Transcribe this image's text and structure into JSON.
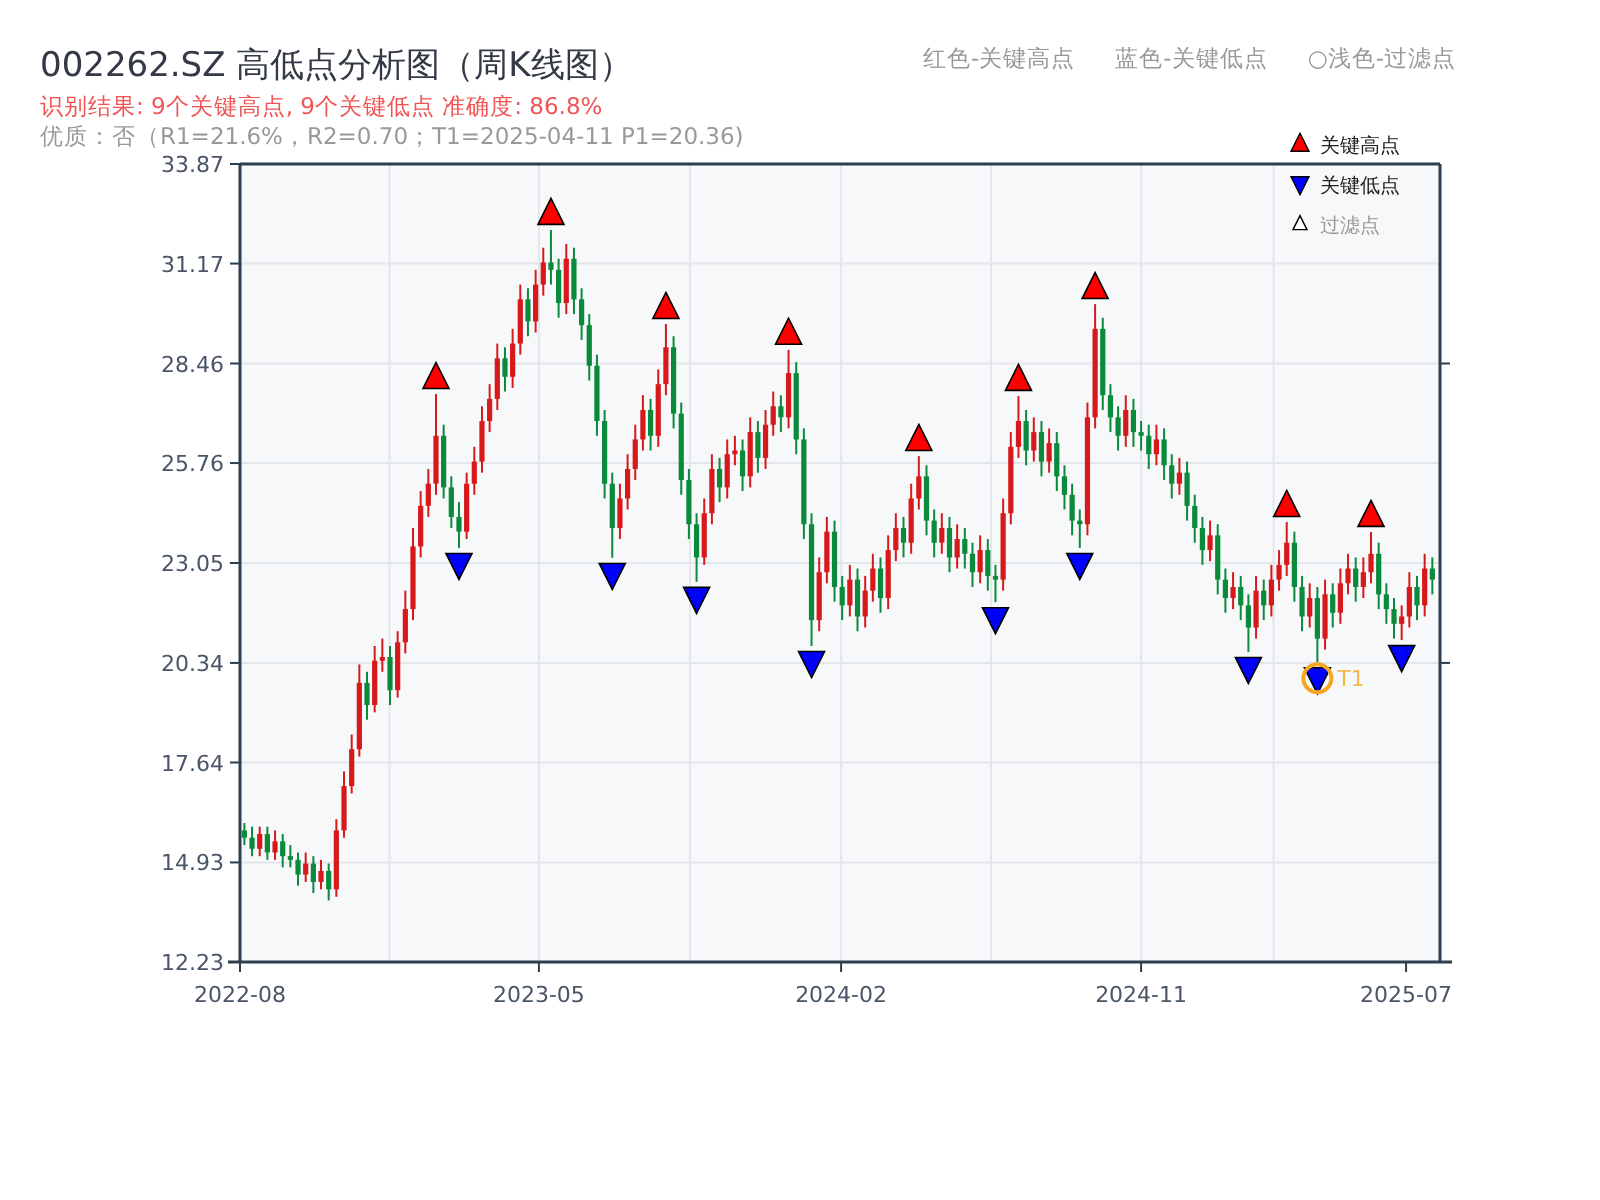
{
  "title": "002262.SZ 高低点分析图（周K线图）",
  "header_legend": [
    "红色-关键高点",
    "蓝色-关键低点",
    "○浅色-过滤点"
  ],
  "result_line": "识别结果: 9个关键高点, 9个关键低点  准确度: 86.8%",
  "quality_line": "优质：否（R1=21.6%，R2=0.70；T1=2025-04-11 P1=20.36)",
  "chart": {
    "filtered_legend": {
      "label": "过滤点"
    },
    "chart_data": {
      "type": "candlestick",
      "grid": true,
      "xlim": [
        "2022-08-01",
        "2025-08-01"
      ],
      "ylim": [
        12.23,
        33.87
      ],
      "xticks": [
        {
          "value": "2022-08-01",
          "label": "2022-08"
        },
        {
          "value": "2023-05-01",
          "label": "2023-05"
        },
        {
          "value": "2024-02-01",
          "label": "2024-02"
        },
        {
          "value": "2024-11-01",
          "label": "2024-11"
        },
        {
          "value": "2025-07-01",
          "label": "2025-07"
        }
      ],
      "yticks": [
        12.23,
        14.93,
        17.64,
        20.34,
        23.05,
        25.76,
        28.46,
        31.17,
        33.87
      ],
      "annotations": [
        {
          "x": "2025-04-11",
          "y": 20.36,
          "text": "T1"
        }
      ],
      "x": [
        "2022-08-05",
        "2022-08-12",
        "2022-08-19",
        "2022-08-26",
        "2022-09-02",
        "2022-09-09",
        "2022-09-16",
        "2022-09-23",
        "2022-09-30",
        "2022-10-07",
        "2022-10-14",
        "2022-10-21",
        "2022-10-28",
        "2022-11-04",
        "2022-11-11",
        "2022-11-18",
        "2022-11-25",
        "2022-12-02",
        "2022-12-09",
        "2022-12-16",
        "2022-12-23",
        "2022-12-30",
        "2023-01-06",
        "2023-01-13",
        "2023-01-20",
        "2023-01-27",
        "2023-02-03",
        "2023-02-10",
        "2023-02-17",
        "2023-02-24",
        "2023-03-03",
        "2023-03-10",
        "2023-03-17",
        "2023-03-24",
        "2023-03-31",
        "2023-04-07",
        "2023-04-14",
        "2023-04-21",
        "2023-04-28",
        "2023-05-05",
        "2023-05-12",
        "2023-05-19",
        "2023-05-26",
        "2023-06-02",
        "2023-06-09",
        "2023-06-16",
        "2023-06-23",
        "2023-06-30",
        "2023-07-07",
        "2023-07-14",
        "2023-07-21",
        "2023-07-28",
        "2023-08-04",
        "2023-08-11",
        "2023-08-18",
        "2023-08-25",
        "2023-09-01",
        "2023-09-08",
        "2023-09-15",
        "2023-09-22",
        "2023-09-29",
        "2023-10-06",
        "2023-10-13",
        "2023-10-20",
        "2023-10-27",
        "2023-11-03",
        "2023-11-10",
        "2023-11-17",
        "2023-11-24",
        "2023-12-01",
        "2023-12-08",
        "2023-12-15",
        "2023-12-22",
        "2023-12-29",
        "2024-01-05",
        "2024-01-12",
        "2024-01-19",
        "2024-01-26",
        "2024-02-02",
        "2024-02-09",
        "2024-02-16",
        "2024-02-23",
        "2024-03-01",
        "2024-03-08",
        "2024-03-15",
        "2024-03-22",
        "2024-03-29",
        "2024-04-05",
        "2024-04-12",
        "2024-04-19",
        "2024-04-26",
        "2024-05-03",
        "2024-05-10",
        "2024-05-17",
        "2024-05-24",
        "2024-05-31",
        "2024-06-07",
        "2024-06-14",
        "2024-06-21",
        "2024-06-28",
        "2024-07-05",
        "2024-07-12",
        "2024-07-19",
        "2024-07-26",
        "2024-08-02",
        "2024-08-09",
        "2024-08-16",
        "2024-08-23",
        "2024-08-30",
        "2024-09-06",
        "2024-09-13",
        "2024-09-20",
        "2024-09-27",
        "2024-10-04",
        "2024-10-11",
        "2024-10-18",
        "2024-10-25",
        "2024-11-01",
        "2024-11-08",
        "2024-11-15",
        "2024-11-22",
        "2024-11-29",
        "2024-12-06",
        "2024-12-13",
        "2024-12-20",
        "2024-12-27",
        "2025-01-03",
        "2025-01-10",
        "2025-01-17",
        "2025-01-24",
        "2025-01-31",
        "2025-02-07",
        "2025-02-14",
        "2025-02-21",
        "2025-02-28",
        "2025-03-07",
        "2025-03-14",
        "2025-03-21",
        "2025-03-28",
        "2025-04-04",
        "2025-04-11",
        "2025-04-18",
        "2025-04-25",
        "2025-05-02",
        "2025-05-09",
        "2025-05-16",
        "2025-05-23",
        "2025-05-30",
        "2025-06-06",
        "2025-06-13",
        "2025-06-20",
        "2025-06-27",
        "2025-07-04",
        "2025-07-11",
        "2025-07-18",
        "2025-07-25"
      ],
      "ohlc": [
        [
          15.8,
          16.0,
          15.4,
          15.6
        ],
        [
          15.6,
          15.9,
          15.1,
          15.3
        ],
        [
          15.3,
          15.9,
          15.1,
          15.7
        ],
        [
          15.7,
          15.9,
          15.0,
          15.2
        ],
        [
          15.2,
          15.8,
          15.0,
          15.5
        ],
        [
          15.5,
          15.7,
          14.8,
          15.1
        ],
        [
          15.1,
          15.4,
          14.8,
          15.0
        ],
        [
          15.0,
          15.2,
          14.3,
          14.6
        ],
        [
          14.6,
          15.2,
          14.4,
          14.9
        ],
        [
          14.9,
          15.1,
          14.1,
          14.4
        ],
        [
          14.4,
          15.0,
          14.2,
          14.7
        ],
        [
          14.7,
          14.9,
          13.9,
          14.2
        ],
        [
          14.2,
          16.1,
          14.0,
          15.8
        ],
        [
          15.8,
          17.4,
          15.6,
          17.0
        ],
        [
          17.0,
          18.4,
          16.8,
          18.0
        ],
        [
          18.0,
          20.3,
          17.8,
          19.8
        ],
        [
          19.8,
          20.1,
          18.8,
          19.2
        ],
        [
          19.2,
          20.8,
          19.0,
          20.4
        ],
        [
          20.4,
          21.0,
          20.1,
          20.5
        ],
        [
          20.5,
          20.8,
          19.2,
          19.6
        ],
        [
          19.6,
          21.2,
          19.4,
          20.9
        ],
        [
          20.9,
          22.3,
          20.6,
          21.8
        ],
        [
          21.8,
          24.0,
          21.5,
          23.5
        ],
        [
          23.5,
          25.0,
          23.2,
          24.6
        ],
        [
          24.6,
          25.6,
          24.3,
          25.2
        ],
        [
          25.2,
          27.63,
          24.9,
          26.5
        ],
        [
          26.5,
          26.8,
          24.8,
          25.1
        ],
        [
          25.1,
          25.4,
          24.0,
          24.3
        ],
        [
          24.3,
          24.7,
          23.46,
          23.9
        ],
        [
          23.9,
          25.5,
          23.7,
          25.2
        ],
        [
          25.2,
          26.2,
          24.9,
          25.8
        ],
        [
          25.8,
          27.3,
          25.5,
          26.9
        ],
        [
          26.9,
          27.9,
          26.6,
          27.5
        ],
        [
          27.5,
          29.0,
          27.2,
          28.6
        ],
        [
          28.6,
          28.9,
          27.7,
          28.1
        ],
        [
          28.1,
          29.4,
          27.8,
          29.0
        ],
        [
          29.0,
          30.6,
          28.7,
          30.2
        ],
        [
          30.2,
          30.5,
          29.2,
          29.6
        ],
        [
          29.6,
          31.0,
          29.3,
          30.6
        ],
        [
          30.6,
          31.6,
          30.3,
          31.2
        ],
        [
          31.2,
          32.08,
          30.6,
          31.0
        ],
        [
          31.0,
          31.3,
          29.7,
          30.1
        ],
        [
          30.1,
          31.7,
          29.8,
          31.3
        ],
        [
          31.3,
          31.6,
          29.8,
          30.2
        ],
        [
          30.2,
          30.5,
          29.1,
          29.5
        ],
        [
          29.5,
          29.8,
          28.0,
          28.4
        ],
        [
          28.4,
          28.7,
          26.5,
          26.9
        ],
        [
          26.9,
          27.2,
          24.8,
          25.2
        ],
        [
          25.2,
          25.5,
          23.19,
          24.0
        ],
        [
          24.0,
          25.2,
          23.7,
          24.8
        ],
        [
          24.8,
          26.0,
          24.5,
          25.6
        ],
        [
          25.6,
          26.8,
          25.3,
          26.4
        ],
        [
          26.4,
          27.6,
          26.1,
          27.2
        ],
        [
          27.2,
          27.5,
          26.1,
          26.5
        ],
        [
          26.5,
          28.3,
          26.2,
          27.9
        ],
        [
          27.9,
          29.53,
          27.6,
          28.9
        ],
        [
          28.9,
          29.2,
          26.7,
          27.1
        ],
        [
          27.1,
          27.4,
          24.9,
          25.3
        ],
        [
          25.3,
          25.6,
          23.7,
          24.1
        ],
        [
          24.1,
          24.4,
          22.54,
          23.2
        ],
        [
          23.2,
          24.8,
          23.0,
          24.4
        ],
        [
          24.4,
          26.0,
          24.1,
          25.6
        ],
        [
          25.6,
          25.9,
          24.7,
          25.1
        ],
        [
          25.1,
          26.4,
          24.8,
          26.0
        ],
        [
          26.0,
          26.5,
          25.7,
          26.1
        ],
        [
          26.1,
          26.4,
          25.0,
          25.4
        ],
        [
          25.4,
          27.0,
          25.1,
          26.6
        ],
        [
          26.6,
          26.9,
          25.5,
          25.9
        ],
        [
          25.9,
          27.2,
          25.6,
          26.8
        ],
        [
          26.8,
          27.7,
          26.5,
          27.3
        ],
        [
          27.3,
          27.6,
          26.6,
          27.0
        ],
        [
          27.0,
          28.83,
          26.7,
          28.2
        ],
        [
          28.2,
          28.5,
          26.0,
          26.4
        ],
        [
          26.4,
          26.7,
          23.7,
          24.1
        ],
        [
          24.1,
          24.4,
          20.8,
          21.5
        ],
        [
          21.5,
          23.2,
          21.2,
          22.8
        ],
        [
          22.8,
          24.3,
          22.5,
          23.9
        ],
        [
          23.9,
          24.2,
          22.0,
          22.4
        ],
        [
          22.4,
          22.7,
          21.5,
          21.9
        ],
        [
          21.9,
          23.0,
          21.6,
          22.6
        ],
        [
          22.6,
          22.9,
          21.2,
          21.6
        ],
        [
          21.6,
          22.7,
          21.3,
          22.3
        ],
        [
          22.3,
          23.3,
          22.0,
          22.9
        ],
        [
          22.9,
          23.2,
          21.7,
          22.1
        ],
        [
          22.1,
          23.8,
          21.8,
          23.4
        ],
        [
          23.4,
          24.4,
          23.1,
          24.0
        ],
        [
          24.0,
          24.3,
          23.2,
          23.6
        ],
        [
          23.6,
          25.2,
          23.3,
          24.8
        ],
        [
          24.8,
          25.95,
          24.5,
          25.4
        ],
        [
          25.4,
          25.7,
          23.8,
          24.2
        ],
        [
          24.2,
          24.5,
          23.2,
          23.6
        ],
        [
          23.6,
          24.4,
          23.3,
          24.0
        ],
        [
          24.0,
          24.3,
          22.8,
          23.2
        ],
        [
          23.2,
          24.1,
          22.9,
          23.7
        ],
        [
          23.7,
          24.0,
          22.9,
          23.3
        ],
        [
          23.3,
          23.6,
          22.4,
          22.8
        ],
        [
          22.8,
          23.8,
          22.5,
          23.4
        ],
        [
          23.4,
          23.7,
          22.3,
          22.7
        ],
        [
          22.7,
          23.0,
          21.99,
          22.6
        ],
        [
          22.6,
          24.8,
          22.3,
          24.4
        ],
        [
          24.4,
          26.6,
          24.1,
          26.2
        ],
        [
          26.2,
          27.58,
          25.9,
          26.9
        ],
        [
          26.9,
          27.2,
          25.7,
          26.1
        ],
        [
          26.1,
          27.0,
          25.8,
          26.6
        ],
        [
          26.6,
          26.9,
          25.4,
          25.8
        ],
        [
          25.8,
          26.7,
          25.5,
          26.3
        ],
        [
          26.3,
          26.6,
          25.0,
          25.4
        ],
        [
          25.4,
          25.7,
          24.5,
          24.9
        ],
        [
          24.9,
          25.2,
          23.8,
          24.2
        ],
        [
          24.2,
          24.5,
          23.46,
          24.1
        ],
        [
          24.1,
          27.4,
          23.8,
          27.0
        ],
        [
          27.0,
          30.07,
          26.7,
          29.4
        ],
        [
          29.4,
          29.7,
          27.2,
          27.6
        ],
        [
          27.6,
          27.9,
          26.6,
          27.0
        ],
        [
          27.0,
          27.3,
          26.1,
          26.5
        ],
        [
          26.5,
          27.6,
          26.2,
          27.2
        ],
        [
          27.2,
          27.5,
          26.2,
          26.6
        ],
        [
          26.6,
          26.9,
          26.1,
          26.5
        ],
        [
          26.5,
          26.8,
          25.6,
          26.0
        ],
        [
          26.0,
          26.8,
          25.7,
          26.4
        ],
        [
          26.4,
          26.7,
          25.3,
          25.7
        ],
        [
          25.7,
          26.0,
          24.8,
          25.2
        ],
        [
          25.2,
          25.9,
          24.9,
          25.5
        ],
        [
          25.5,
          25.8,
          24.2,
          24.6
        ],
        [
          24.6,
          24.9,
          23.6,
          24.0
        ],
        [
          24.0,
          24.3,
          23.0,
          23.4
        ],
        [
          23.4,
          24.2,
          23.1,
          23.8
        ],
        [
          23.8,
          24.1,
          22.2,
          22.6
        ],
        [
          22.6,
          22.9,
          21.7,
          22.1
        ],
        [
          22.1,
          22.8,
          21.8,
          22.4
        ],
        [
          22.4,
          22.7,
          21.5,
          21.9
        ],
        [
          21.9,
          22.2,
          20.64,
          21.3
        ],
        [
          21.3,
          22.7,
          21.0,
          22.3
        ],
        [
          22.3,
          22.6,
          21.5,
          21.9
        ],
        [
          21.9,
          23.0,
          21.6,
          22.6
        ],
        [
          22.6,
          23.4,
          22.3,
          23.0
        ],
        [
          23.0,
          24.16,
          22.7,
          23.6
        ],
        [
          23.6,
          23.9,
          22.0,
          22.4
        ],
        [
          22.4,
          22.7,
          21.2,
          21.6
        ],
        [
          21.6,
          22.5,
          21.3,
          22.1
        ],
        [
          22.1,
          22.4,
          20.36,
          21.0
        ],
        [
          21.0,
          22.6,
          20.7,
          22.2
        ],
        [
          22.2,
          22.5,
          21.3,
          21.7
        ],
        [
          21.7,
          22.9,
          21.4,
          22.5
        ],
        [
          22.5,
          23.3,
          22.2,
          22.9
        ],
        [
          22.9,
          23.2,
          22.0,
          22.4
        ],
        [
          22.4,
          23.2,
          22.1,
          22.8
        ],
        [
          22.8,
          23.89,
          22.5,
          23.3
        ],
        [
          23.3,
          23.6,
          21.8,
          22.2
        ],
        [
          22.2,
          22.5,
          21.4,
          21.8
        ],
        [
          21.8,
          22.1,
          21.0,
          21.4
        ],
        [
          21.4,
          21.9,
          20.96,
          21.6
        ],
        [
          21.6,
          22.8,
          21.3,
          22.4
        ],
        [
          22.4,
          22.7,
          21.5,
          21.9
        ],
        [
          21.9,
          23.3,
          21.6,
          22.9
        ],
        [
          22.9,
          23.2,
          22.2,
          22.6
        ]
      ]
    },
    "key_points": [
      {
        "name": "关键高点",
        "kind": "high",
        "color": "#ff0000",
        "flagged": [
          false,
          false,
          false,
          false,
          false,
          false,
          false,
          false,
          false,
          false,
          false,
          false,
          false,
          false,
          false,
          false,
          false,
          false,
          false,
          false,
          false,
          false,
          false,
          false,
          false,
          true,
          false,
          false,
          false,
          false,
          false,
          false,
          false,
          false,
          false,
          false,
          false,
          false,
          false,
          false,
          true,
          false,
          false,
          false,
          false,
          false,
          false,
          false,
          false,
          false,
          false,
          false,
          false,
          false,
          false,
          true,
          false,
          false,
          false,
          false,
          false,
          false,
          false,
          false,
          false,
          false,
          false,
          false,
          false,
          false,
          false,
          true,
          false,
          false,
          false,
          false,
          false,
          false,
          false,
          false,
          false,
          false,
          false,
          false,
          false,
          false,
          false,
          false,
          true,
          false,
          false,
          false,
          false,
          false,
          false,
          false,
          false,
          false,
          false,
          false,
          false,
          true,
          false,
          false,
          false,
          false,
          false,
          false,
          false,
          false,
          false,
          true,
          false,
          false,
          false,
          false,
          false,
          false,
          false,
          false,
          false,
          false,
          false,
          false,
          false,
          false,
          false,
          false,
          false,
          false,
          false,
          false,
          false,
          false,
          false,
          false,
          true,
          false,
          false,
          false,
          false,
          false,
          false,
          false,
          false,
          false,
          false,
          true,
          false,
          false,
          false,
          false,
          false,
          false,
          false,
          false
        ]
      },
      {
        "name": "关键低点",
        "kind": "low",
        "color": "#0000ff",
        "flagged": [
          false,
          false,
          false,
          false,
          false,
          false,
          false,
          false,
          false,
          false,
          false,
          false,
          false,
          false,
          false,
          false,
          false,
          false,
          false,
          false,
          false,
          false,
          false,
          false,
          false,
          false,
          false,
          false,
          true,
          false,
          false,
          false,
          false,
          false,
          false,
          false,
          false,
          false,
          false,
          false,
          false,
          false,
          false,
          false,
          false,
          false,
          false,
          false,
          true,
          false,
          false,
          false,
          false,
          false,
          false,
          false,
          false,
          false,
          false,
          true,
          false,
          false,
          false,
          false,
          false,
          false,
          false,
          false,
          false,
          false,
          false,
          false,
          false,
          false,
          true,
          false,
          false,
          false,
          false,
          false,
          false,
          false,
          false,
          false,
          false,
          false,
          false,
          false,
          false,
          false,
          false,
          false,
          false,
          false,
          false,
          false,
          false,
          false,
          true,
          false,
          false,
          false,
          false,
          false,
          false,
          false,
          false,
          false,
          false,
          true,
          false,
          false,
          false,
          false,
          false,
          false,
          false,
          false,
          false,
          false,
          false,
          false,
          false,
          false,
          false,
          false,
          false,
          false,
          false,
          false,
          false,
          true,
          false,
          false,
          false,
          false,
          false,
          false,
          false,
          false,
          true,
          false,
          false,
          false,
          false,
          false,
          false,
          false,
          false,
          false,
          false,
          true,
          false,
          false,
          false,
          false
        ]
      }
    ]
  }
}
